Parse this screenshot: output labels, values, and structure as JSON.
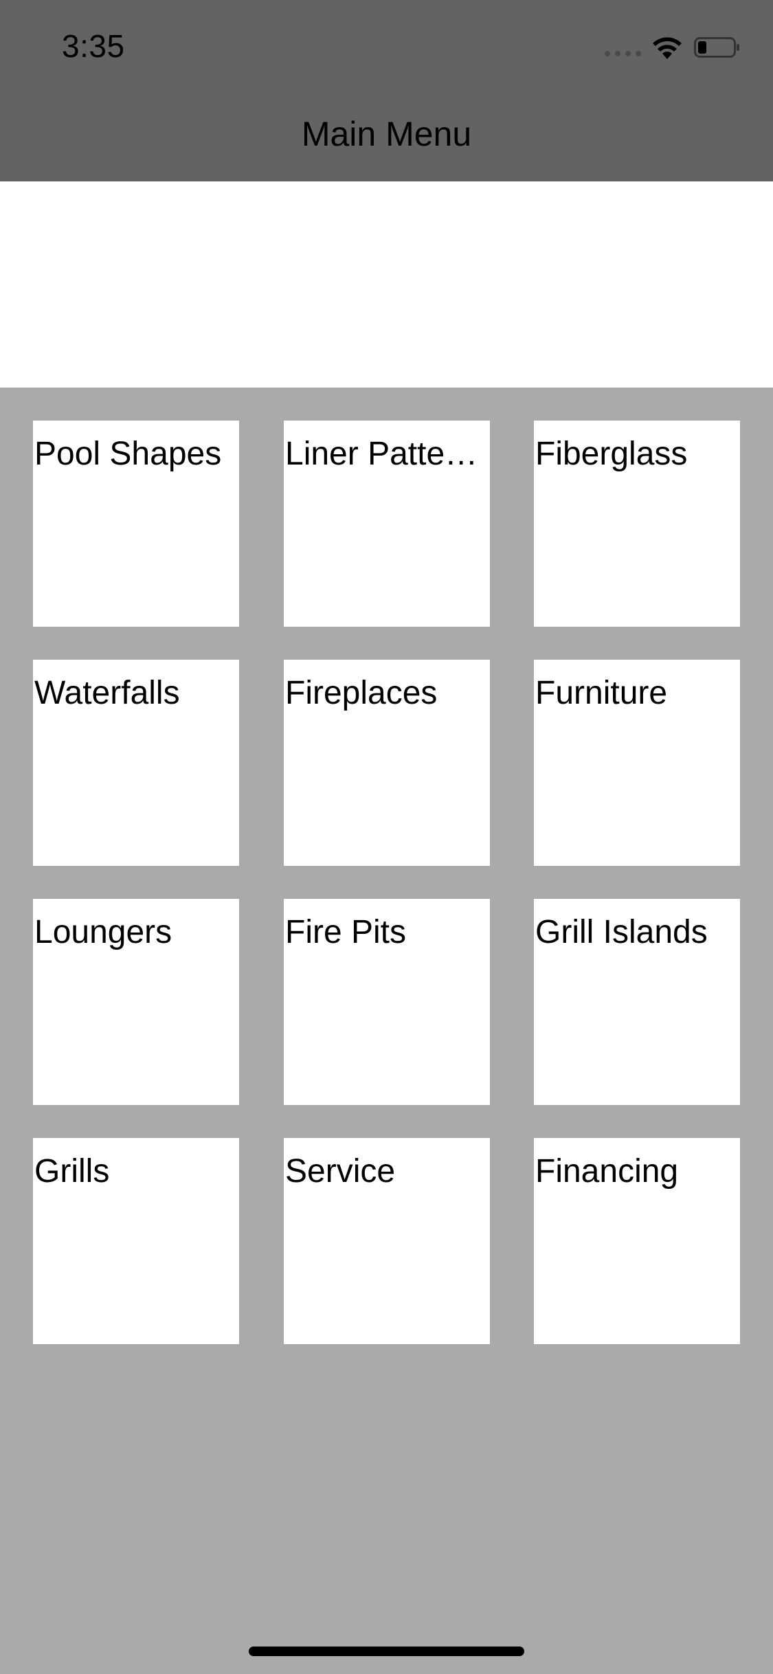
{
  "status_bar": {
    "time": "3:35",
    "signal_icon": "cellular-signal-icon",
    "wifi_icon": "wifi-icon",
    "battery_icon": "battery-icon"
  },
  "nav": {
    "title": "Main Menu"
  },
  "menu": {
    "items": [
      {
        "label": "Pool Shapes",
        "icon": "none"
      },
      {
        "label": "Liner Patterns"
      },
      {
        "label": "Fiberglass"
      },
      {
        "label": "Waterfalls"
      },
      {
        "label": "Fireplaces"
      },
      {
        "label": "Furniture"
      },
      {
        "label": "Loungers"
      },
      {
        "label": "Fire Pits"
      },
      {
        "label": "Grill Islands"
      },
      {
        "label": "Grills"
      },
      {
        "label": "Service"
      },
      {
        "label": "Financing"
      }
    ]
  },
  "colors": {
    "nav_background": "#636363",
    "page_background": "#aaaaaa",
    "tile_background": "#ffffff"
  }
}
